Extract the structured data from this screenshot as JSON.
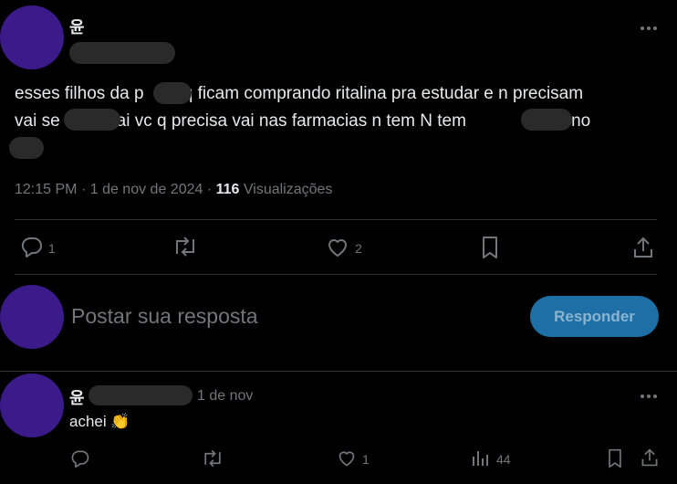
{
  "main_post": {
    "author_name": "윤",
    "text_line1_a": "esses filhos da p",
    "text_line1_b": " q ficam comprando ritalina pra estudar e n precisam",
    "text_line2_a": "vai se",
    "text_line2_b": "ai vc q precisa vai nas farmacias n tem N tem ",
    "text_line2_c": "tomar no",
    "time": "12:15 PM",
    "sep1": "·",
    "date": "1 de nov de 2024",
    "sep2": "·",
    "views_count": "116",
    "views_label": "Visualizações",
    "replies": "1",
    "likes": "2"
  },
  "composer": {
    "placeholder": "Postar sua resposta",
    "reply_button": "Responder"
  },
  "reply_post": {
    "author_name": "윤",
    "date": "1 de nov",
    "text": "achei",
    "emoji": "👏",
    "likes": "1",
    "views": "44"
  },
  "colors": {
    "background": "#000000",
    "avatar": "#3b1a8a",
    "button": "#1d6fa5",
    "muted": "#71767b"
  },
  "icons": [
    "more-icon",
    "reply-icon",
    "retweet-icon",
    "like-icon",
    "bookmark-icon",
    "share-icon",
    "views-icon"
  ]
}
